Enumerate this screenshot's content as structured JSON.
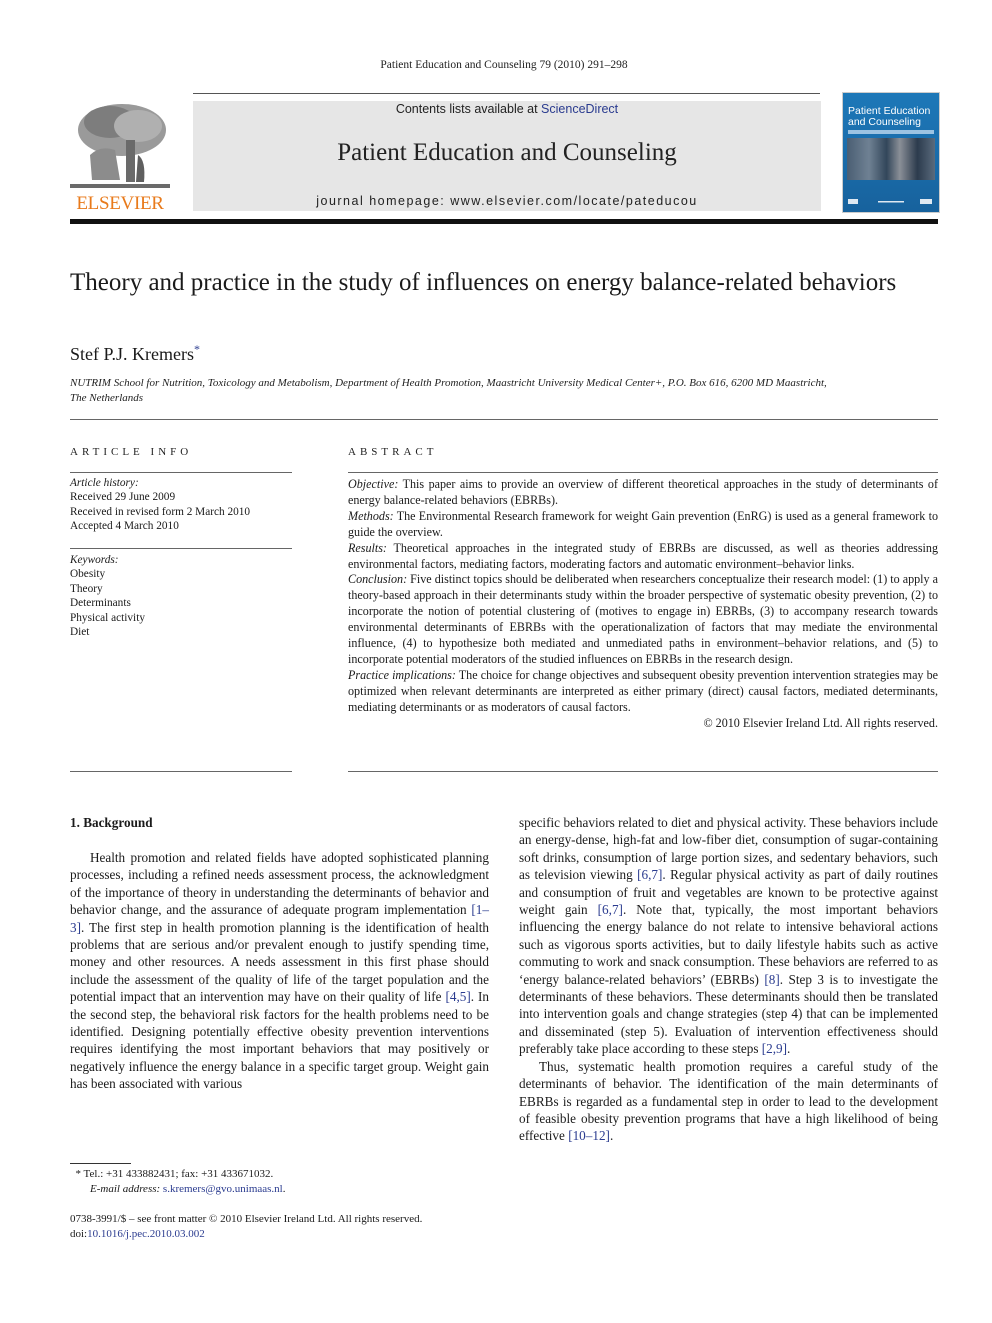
{
  "running_head": "Patient Education and Counseling 79 (2010) 291–298",
  "publisher_logo": {
    "icon": "elsevier-tree-icon",
    "name": "ELSEVIER",
    "color": "#e87a1b"
  },
  "banner": {
    "contents_prefix": "Contents lists available at ",
    "contents_link": "ScienceDirect",
    "journal_title": "Patient Education and Counseling",
    "homepage": "journal homepage: www.elsevier.com/locate/pateducou"
  },
  "cover": {
    "title_line1": "Patient Education",
    "title_line2": "and Counseling",
    "color": "#1b6fae"
  },
  "article": {
    "title": "Theory and practice in the study of influences on energy balance-related behaviors",
    "author": "Stef P.J. Kremers",
    "author_mark": "*",
    "affiliation_line1": "NUTRIM School for Nutrition, Toxicology and Metabolism, Department of Health Promotion, Maastricht University Medical Center+, P.O. Box 616, 6200 MD Maastricht,",
    "affiliation_line2": "The Netherlands"
  },
  "article_info": {
    "heading": "ARTICLE INFO",
    "history_label": "Article history:",
    "history": [
      "Received 29 June 2009",
      "Received in revised form 2 March 2010",
      "Accepted 4 March 2010"
    ],
    "keywords_label": "Keywords:",
    "keywords": [
      "Obesity",
      "Theory",
      "Determinants",
      "Physical activity",
      "Diet"
    ]
  },
  "abstract": {
    "heading": "ABSTRACT",
    "sections": [
      {
        "label": "Objective:",
        "text": " This paper aims to provide an overview of different theoretical approaches in the study of determinants of energy balance-related behaviors (EBRBs)."
      },
      {
        "label": "Methods:",
        "text": " The Environmental Research framework for weight Gain prevention (EnRG) is used as a general framework to guide the overview."
      },
      {
        "label": "Results:",
        "text": " Theoretical approaches in the integrated study of EBRBs are discussed, as well as theories addressing environmental factors, mediating factors, moderating factors and automatic environment–behavior links."
      },
      {
        "label": "Conclusion:",
        "text": " Five distinct topics should be deliberated when researchers conceptualize their research model: (1) to apply a theory-based approach in their determinants study within the broader perspective of systematic obesity prevention, (2) to incorporate the notion of potential clustering of (motives to engage in) EBRBs, (3) to accompany research towards environmental determinants of EBRBs with the operationalization of factors that may mediate the environmental influence, (4) to hypothesize both mediated and unmediated paths in environment–behavior relations, and (5) to incorporate potential moderators of the studied influences on EBRBs in the research design."
      },
      {
        "label": "Practice implications:",
        "text": "  The choice for change objectives and subsequent obesity prevention intervention strategies may be optimized when relevant determinants are interpreted as either primary (direct) causal factors, mediated determinants, mediating determinants or as moderators of causal factors."
      }
    ],
    "copyright": "© 2010 Elsevier Ireland Ltd. All rights reserved."
  },
  "body": {
    "section_heading": "1.  Background",
    "left_col": {
      "p1_a": "Health promotion and related fields have adopted sophisticated planning processes, including a refined needs assessment process, the acknowledgment of the importance of theory in understanding the determinants of behavior and behavior change, and the assurance of adequate program implementation ",
      "ref1": "[1–3]",
      "p1_b": ". The first step in health promotion planning is the identification of health problems that are serious and/or prevalent enough to justify spending time, money and other resources. A needs assessment in this first phase should include the assessment of the quality of life of the target population and the potential impact that an intervention may have on their quality of life ",
      "ref2": "[4,5]",
      "p1_c": ". In the second step, the behavioral risk factors for the health problems need to be identified. Designing potentially effective obesity prevention interventions requires identifying the most important behaviors that may positively or negatively influence the energy balance in a specific target group. Weight gain has been associated with various"
    },
    "right_col": {
      "p1_a": "specific behaviors related to diet and physical activity. These behaviors include an energy-dense, high-fat and low-fiber diet, consumption of sugar-containing soft drinks, consumption of large portion sizes, and sedentary behaviors, such as television viewing ",
      "ref1": "[6,7]",
      "p1_b": ". Regular physical activity as part of daily routines and consumption of fruit and vegetables are known to be protective against weight gain ",
      "ref2": "[6,7]",
      "p1_c": ". Note that, typically, the most important behaviors influencing the energy balance do not relate to intensive behavioral actions such as vigorous sports activities, but to daily lifestyle habits such as active commuting to work and snack consumption. These behaviors are referred to as ‘energy balance-related behaviors’ (EBRBs) ",
      "ref3": "[8]",
      "p1_d": ". Step 3 is to investigate the determinants of these behaviors. These determinants should then be translated into intervention goals and change strategies (step 4) that can be implemented and disseminated (step 5). Evaluation of intervention effectiveness should preferably take place according to these steps ",
      "ref4": "[2,9]",
      "p1_e": ".",
      "p2_a": "Thus, systematic health promotion requires a careful study of the determinants of behavior. The identification of the main determinants of EBRBs is regarded as a fundamental step in order to lead to the development of feasible obesity prevention programs that have a high likelihood of being effective ",
      "ref5": "[10–12]",
      "p2_b": "."
    }
  },
  "footnote": {
    "mark": "*",
    "contact": " Tel.: +31 433882431; fax: +31 433671032.",
    "email_label": "E-mail address:",
    "email": "s.kremers@gvo.unimaas.nl",
    "email_end": "."
  },
  "front_matter": {
    "issn_line": "0738-3991/$ – see front matter © 2010 Elsevier Ireland Ltd. All rights reserved.",
    "doi_prefix": "doi:",
    "doi": "10.1016/j.pec.2010.03.002"
  }
}
